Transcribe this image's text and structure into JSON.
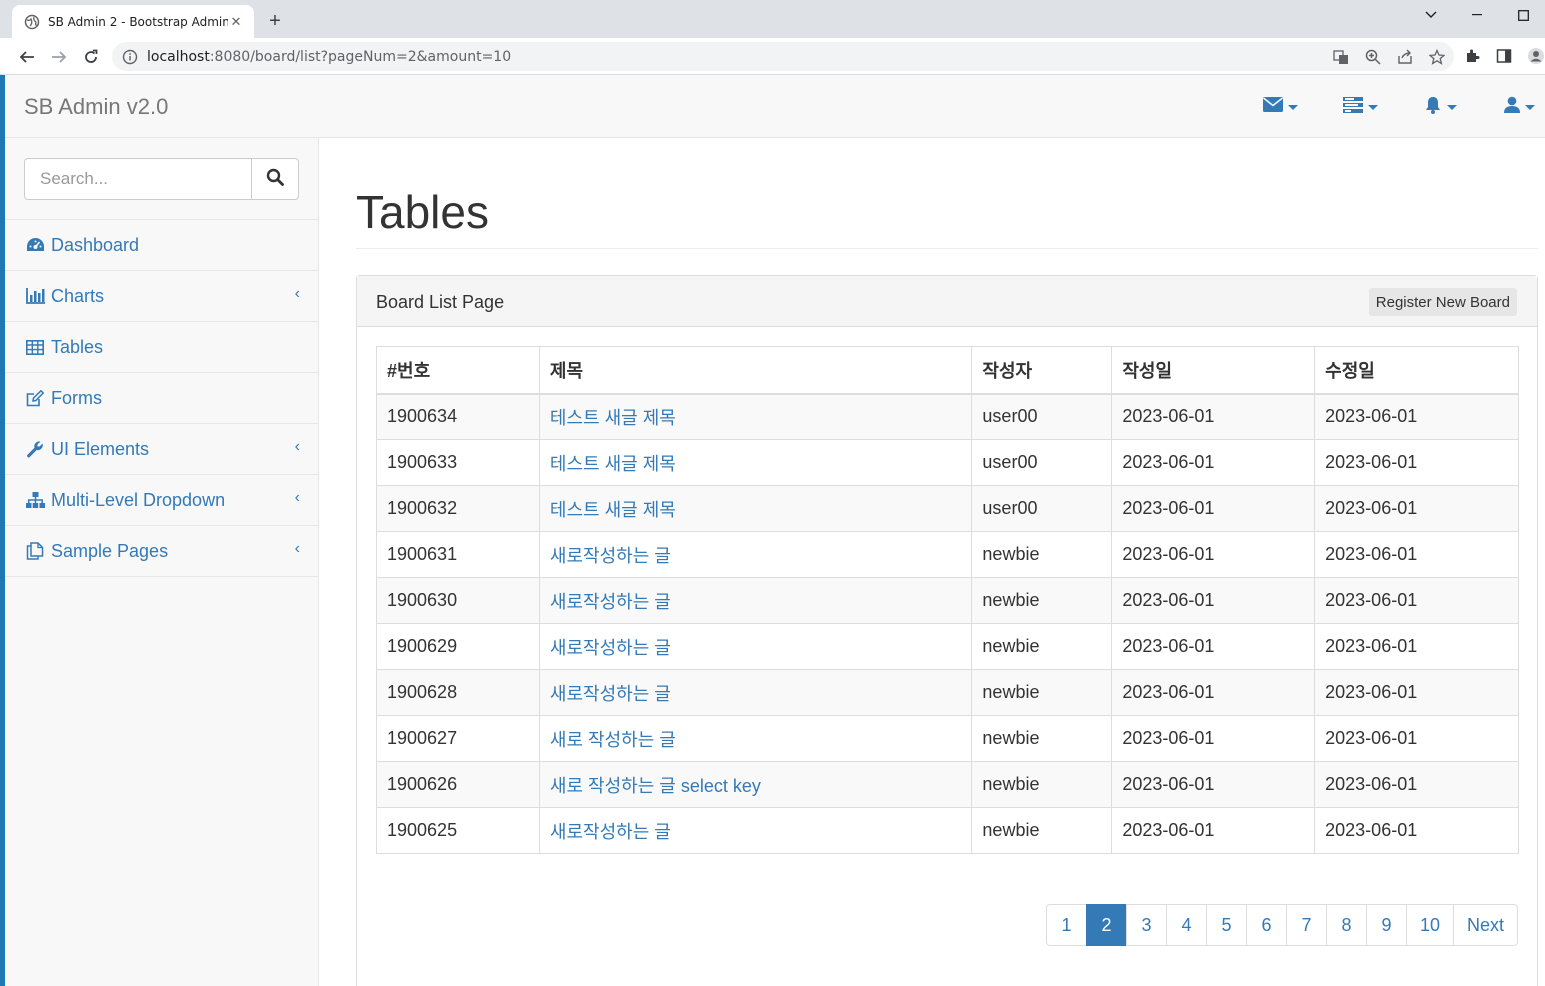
{
  "browser": {
    "tab_title": "SB Admin 2 - Bootstrap Admin",
    "url_host": "localhost",
    "url_path": ":8080/board/list?pageNum=2&amount=10"
  },
  "app": {
    "brand": "SB Admin v2.0"
  },
  "sidebar": {
    "search_placeholder": "Search...",
    "items": [
      {
        "label": "Dashboard",
        "icon": "dashboard-icon",
        "has_arrow": false
      },
      {
        "label": "Charts",
        "icon": "bar-chart-icon",
        "has_arrow": true
      },
      {
        "label": "Tables",
        "icon": "table-icon",
        "has_arrow": false
      },
      {
        "label": "Forms",
        "icon": "edit-icon",
        "has_arrow": false
      },
      {
        "label": "UI Elements",
        "icon": "wrench-icon",
        "has_arrow": true
      },
      {
        "label": "Multi-Level Dropdown",
        "icon": "sitemap-icon",
        "has_arrow": true
      },
      {
        "label": "Sample Pages",
        "icon": "files-icon",
        "has_arrow": true
      }
    ]
  },
  "page": {
    "title": "Tables",
    "panel_title": "Board List Page",
    "register_button": "Register New Board"
  },
  "table": {
    "headers": [
      "#번호",
      "제목",
      "작성자",
      "작성일",
      "수정일"
    ],
    "rows": [
      {
        "no": "1900634",
        "title": "테스트 새글 제목",
        "writer": "user00",
        "regdate": "2023-06-01",
        "updatedate": "2023-06-01"
      },
      {
        "no": "1900633",
        "title": "테스트 새글 제목",
        "writer": "user00",
        "regdate": "2023-06-01",
        "updatedate": "2023-06-01"
      },
      {
        "no": "1900632",
        "title": "테스트 새글 제목",
        "writer": "user00",
        "regdate": "2023-06-01",
        "updatedate": "2023-06-01"
      },
      {
        "no": "1900631",
        "title": "새로작성하는 글",
        "writer": "newbie",
        "regdate": "2023-06-01",
        "updatedate": "2023-06-01"
      },
      {
        "no": "1900630",
        "title": "새로작성하는 글",
        "writer": "newbie",
        "regdate": "2023-06-01",
        "updatedate": "2023-06-01"
      },
      {
        "no": "1900629",
        "title": "새로작성하는 글",
        "writer": "newbie",
        "regdate": "2023-06-01",
        "updatedate": "2023-06-01"
      },
      {
        "no": "1900628",
        "title": "새로작성하는 글",
        "writer": "newbie",
        "regdate": "2023-06-01",
        "updatedate": "2023-06-01"
      },
      {
        "no": "1900627",
        "title": "새로 작성하는 글",
        "writer": "newbie",
        "regdate": "2023-06-01",
        "updatedate": "2023-06-01"
      },
      {
        "no": "1900626",
        "title": "새로 작성하는 글 select key",
        "writer": "newbie",
        "regdate": "2023-06-01",
        "updatedate": "2023-06-01"
      },
      {
        "no": "1900625",
        "title": "새로작성하는 글",
        "writer": "newbie",
        "regdate": "2023-06-01",
        "updatedate": "2023-06-01"
      }
    ]
  },
  "pagination": {
    "pages": [
      "1",
      "2",
      "3",
      "4",
      "5",
      "6",
      "7",
      "8",
      "9",
      "10"
    ],
    "active": "2",
    "next_label": "Next"
  },
  "colors": {
    "link": "#337ab7",
    "sidebar_bg": "#f8f8f8",
    "active_page": "#337ab7"
  }
}
